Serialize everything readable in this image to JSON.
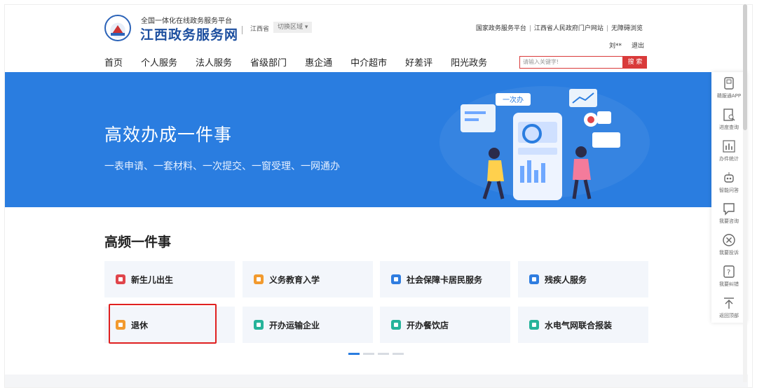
{
  "header": {
    "logo_sub": "全国一体化在线政务服务平台",
    "logo_title": "江西政务服务网",
    "region": "江西省",
    "region_switch": "切换区域",
    "top_links": [
      "国家政务服务平台",
      "江西省人民政府门户网站",
      "无障碍浏览"
    ],
    "user": "刘**",
    "logout": "退出"
  },
  "nav": {
    "items": [
      "首页",
      "个人服务",
      "法人服务",
      "省级部门",
      "惠企通",
      "中介超市",
      "好差评",
      "阳光政务"
    ]
  },
  "search": {
    "placeholder": "请输入关键字!",
    "button": "搜 索"
  },
  "banner": {
    "title": "高效办成一件事",
    "subtitle": "一表申请、一套材料、一次提交、一窗受理、一网通办",
    "badge": "一次办"
  },
  "section": {
    "title": "高频一件事",
    "cards": [
      {
        "label": "新生儿出生",
        "color": "#e0454b"
      },
      {
        "label": "义务教育入学",
        "color": "#f29a2e"
      },
      {
        "label": "社会保障卡居民服务",
        "color": "#2f7de0"
      },
      {
        "label": "残疾人服务",
        "color": "#2f7de0"
      },
      {
        "label": "退休",
        "color": "#f29a2e"
      },
      {
        "label": "开办运输企业",
        "color": "#26b39a"
      },
      {
        "label": "开办餐饮店",
        "color": "#26b39a"
      },
      {
        "label": "水电气网联合报装",
        "color": "#26b39a"
      }
    ],
    "pagination_pages": 4,
    "pagination_active": 1
  },
  "float_bar": {
    "items": [
      {
        "label": "赣服通APP",
        "icon": "phone-icon"
      },
      {
        "label": "进度查询",
        "icon": "document-search-icon"
      },
      {
        "label": "办件统计",
        "icon": "bar-chart-icon"
      },
      {
        "label": "智能问答",
        "icon": "robot-icon"
      },
      {
        "label": "我要咨询",
        "icon": "chat-icon"
      },
      {
        "label": "我要投诉",
        "icon": "complaint-icon"
      },
      {
        "label": "我要纠错",
        "icon": "question-icon"
      },
      {
        "label": "返回顶部",
        "icon": "arrow-up-icon"
      }
    ]
  },
  "colors": {
    "brand_blue": "#2a7de0",
    "title_blue": "#1d4f9f",
    "search_red": "#d93a3a",
    "highlight_red": "#e02020"
  }
}
